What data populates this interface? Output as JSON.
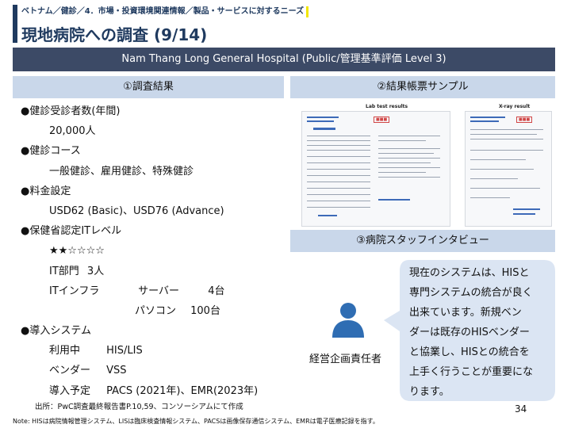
{
  "breadcrumb": "ベトナム／健診／4．市場・投資環境関連情報／製品・サービスに対するニーズ",
  "title": "現地病院への調査 (9/14)",
  "hospital": "Nam Thang Long General Hospital (Public/管理基準評価 Level 3)",
  "sections": {
    "results_header": "①調査結果",
    "sample_header": "②結果帳票サンプル",
    "interview_header": "③病院スタッフインタビュー"
  },
  "results": {
    "exam_count_label": "●健診受診者数(年間)",
    "exam_count_value": "20,000人",
    "course_label": "●健診コース",
    "course_value": "一般健診、雇用健診、特殊健診",
    "fee_label": "●料金設定",
    "fee_value": "USD62 (Basic)、USD76 (Advance)",
    "it_level_label": "●保健省認定ITレベル",
    "it_level_stars": "★★☆☆☆☆",
    "it_dept_label": "IT部門",
    "it_dept_value": "3人",
    "it_infra_label": "ITインフラ",
    "server_label": "サーバー",
    "server_value": "4台",
    "pc_label": "パソコン",
    "pc_value": "100台",
    "system_label": "●導入システム",
    "in_use_label": "利用中",
    "in_use_value": "HIS/LIS",
    "vendor_label": "ベンダー",
    "vendor_value": "VSS",
    "planned_label": "導入予定",
    "planned_value": "PACS (2021年)、EMR(2023年)"
  },
  "samples": {
    "lab_title": "Lab test results",
    "xray_title": "X-ray result"
  },
  "interview": {
    "role": "経営企画責任者",
    "quote_lines": [
      "現在のシステムは、HISと",
      "専門システムの統合が良く",
      "出来ています。新規ベン",
      "ダーは既存のHISベンダー",
      "と協業し、HISとの統合を",
      "上手く行うことが重要にな",
      "ります。"
    ]
  },
  "footer": {
    "source": "出所：PwC調査最終報告書P.10,59、コンソーシアムにて作成",
    "note": "Note: HISは病院情報管理システム、LISは臨床検査情報システム、PACSは画像保存通信システム、EMRは電子医療記録を指す。",
    "page": "34"
  },
  "colors": {
    "navy": "#1f3a5f",
    "bar": "#3c4a66",
    "section_bg": "#c9d7ea",
    "bubble_bg": "#dbe5f3",
    "icon_blue": "#2f6db3",
    "accent_yellow": "#f2e600"
  }
}
